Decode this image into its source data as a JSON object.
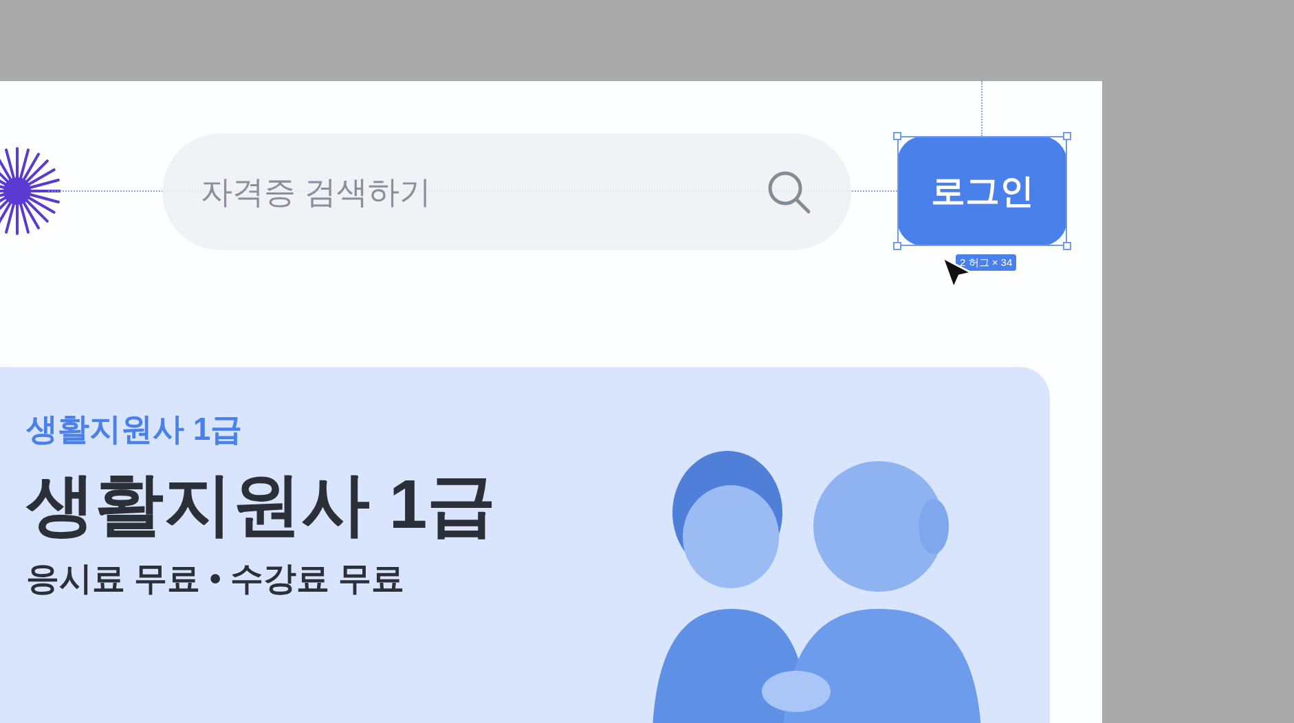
{
  "header": {
    "search": {
      "placeholder": "자격증 검색하기"
    },
    "login_button": "로그인",
    "selected": true,
    "size_label": "2 허그 × 34"
  },
  "hero": {
    "eyebrow": "생활지원사 1급",
    "title": "생활지원사 1급",
    "subtitle": "응시료 무료 • 수강료 무료"
  }
}
